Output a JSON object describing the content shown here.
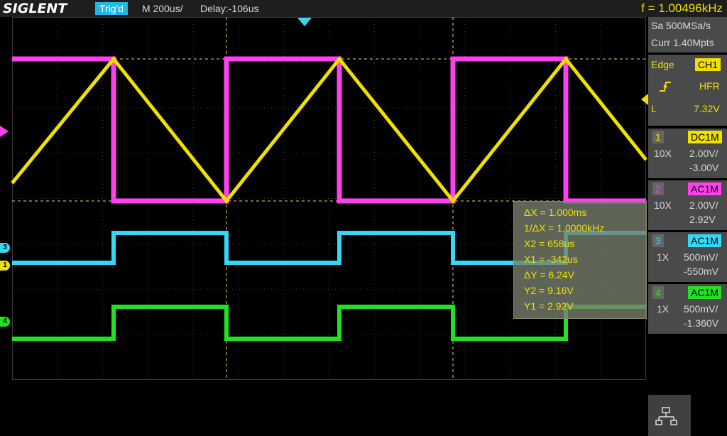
{
  "header": {
    "brand": "SIGLENT",
    "trigger_status": "Trig'd",
    "timebase": "M 200us/",
    "delay": "Delay:-106us",
    "frequency": "f = 1.00496kHz"
  },
  "acquisition": {
    "sample_rate": "Sa 500MSa/s",
    "memory": "Curr 1.40Mpts"
  },
  "trigger": {
    "type": "Edge",
    "source": "CH1",
    "slope_icon": "rising-edge-icon",
    "coupling": "HFR",
    "level_label": "L",
    "level": "7.32V"
  },
  "channels": [
    {
      "num": "1",
      "coupling": "DC1M",
      "probe": "10X",
      "scale": "2.00V/",
      "offset": "-3.00V",
      "color": "#f0e000"
    },
    {
      "num": "2",
      "coupling": "AC1M",
      "probe": "10X",
      "scale": "2.00V/",
      "offset": "2.92V",
      "color": "#ff3ff0"
    },
    {
      "num": "3",
      "coupling": "AC1M",
      "probe": "1X",
      "scale": "500mV/",
      "offset": "-550mV",
      "color": "#33d8f5"
    },
    {
      "num": "4",
      "coupling": "AC1M",
      "probe": "1X",
      "scale": "500mV/",
      "offset": "-1.360V",
      "color": "#22e022"
    }
  ],
  "cursors": {
    "dx": "ΔX = 1.000ms",
    "inv_dx": "1/ΔX = 1.0000kHz",
    "x2": "X2 = 658us",
    "x1": "X1 = -342us",
    "dy": "ΔY = 6.24V",
    "y2": "Y2 = 9.16V",
    "y1": "Y1 = 2.92V"
  },
  "channel_markers": [
    {
      "label": "3",
      "color": "#33d8f5"
    },
    {
      "label": "1",
      "color": "#f0e000"
    },
    {
      "label": "4",
      "color": "#22e022"
    }
  ],
  "icons": {
    "network": "network-icon",
    "trigger_position": "trigger-position-icon",
    "trigger_level": "trigger-level-icon"
  }
}
